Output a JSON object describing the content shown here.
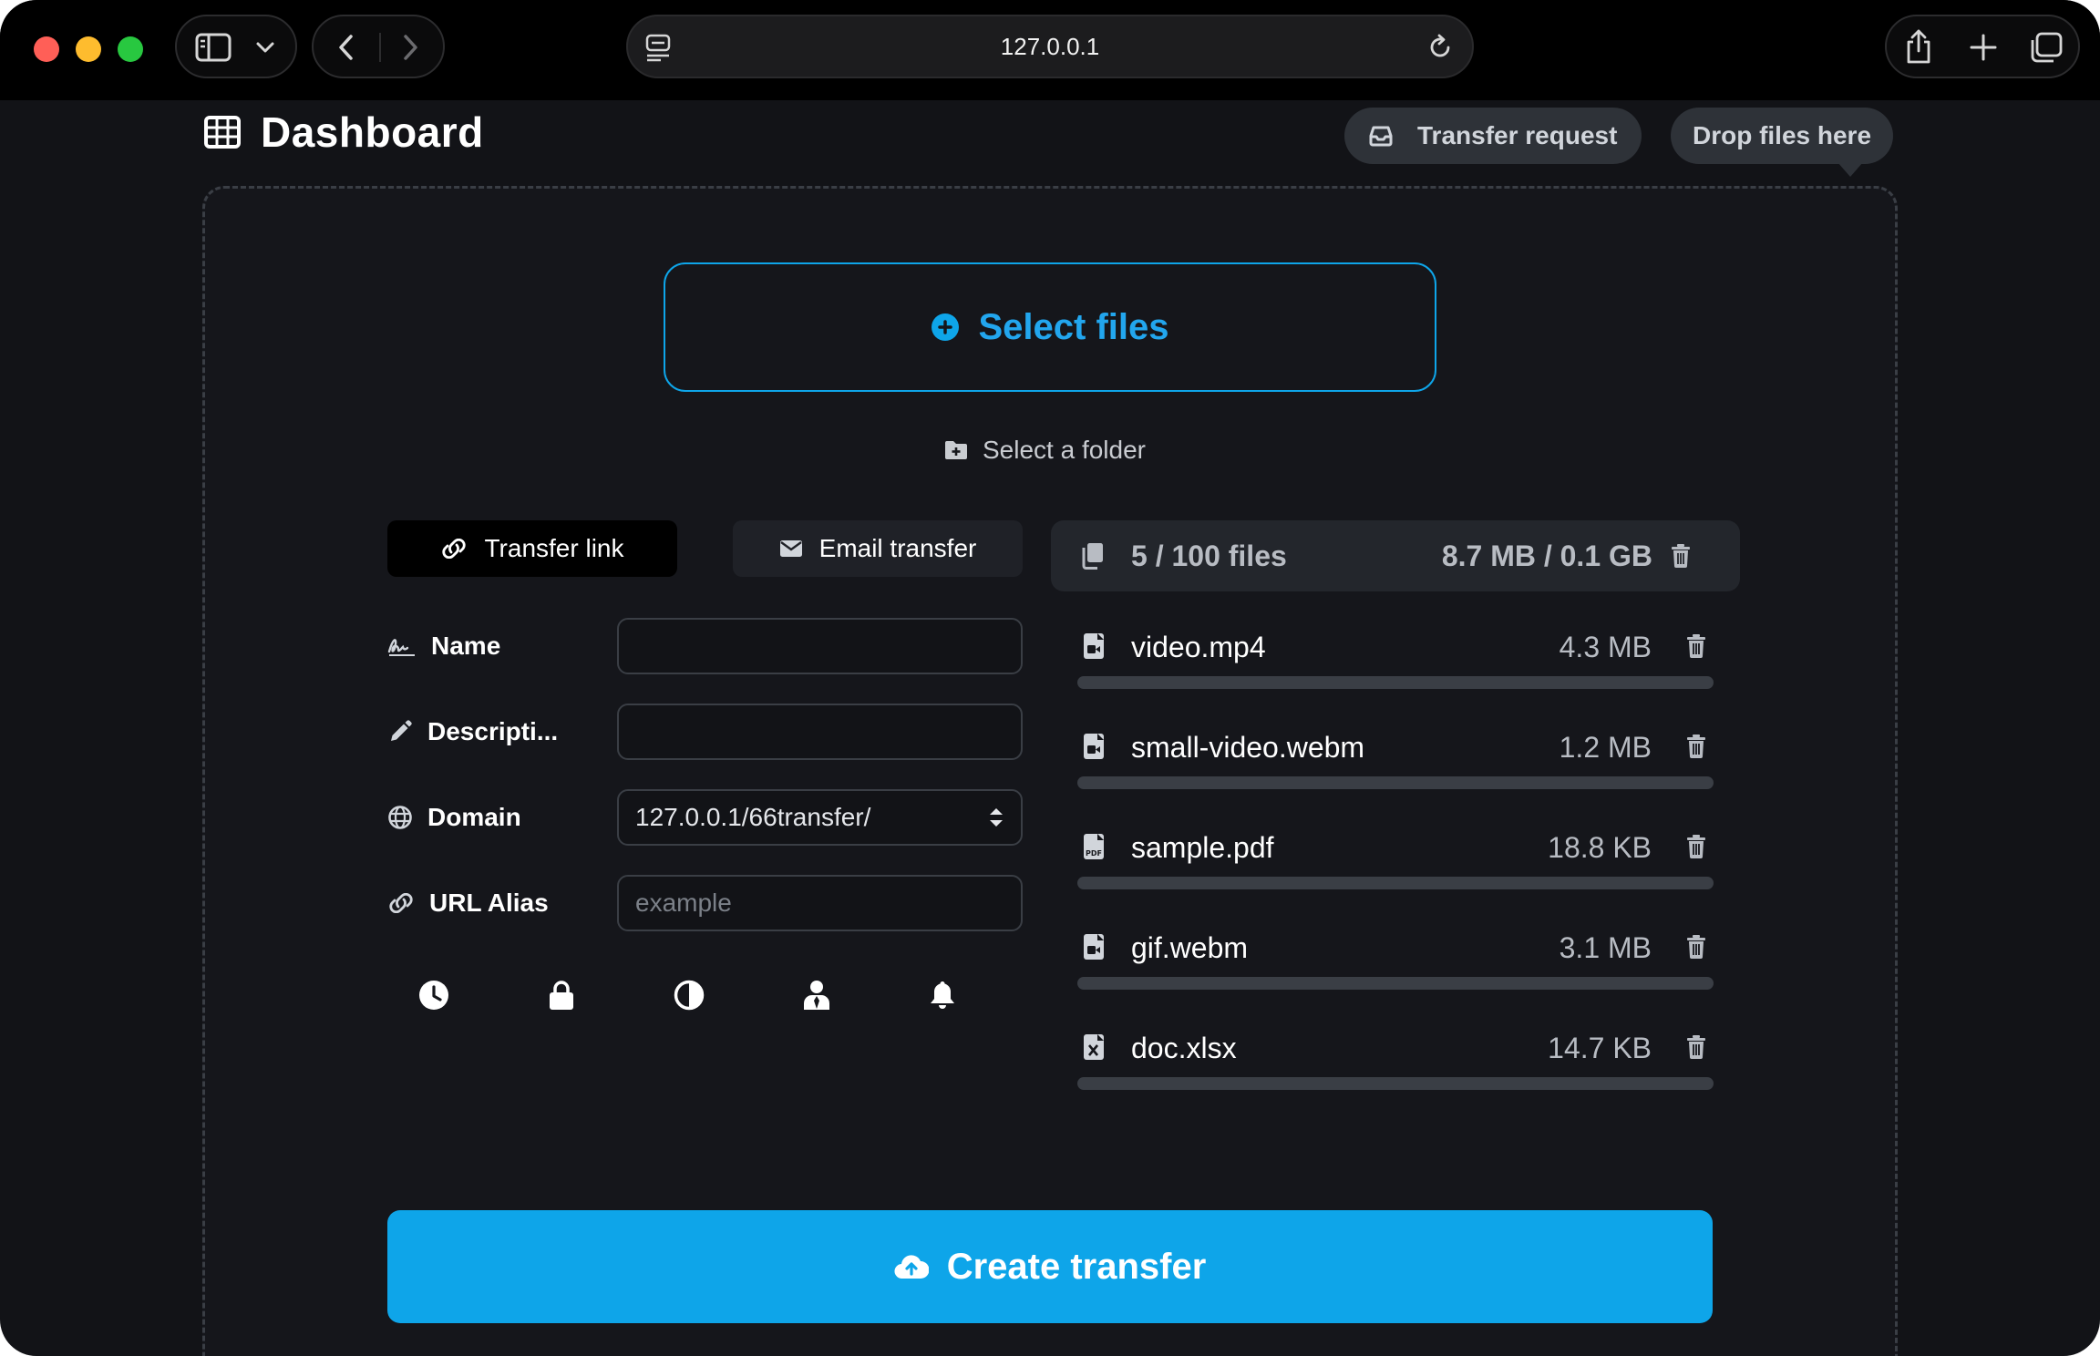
{
  "browser": {
    "url": "127.0.0.1"
  },
  "header": {
    "title": "Dashboard",
    "transfer_request_label": "Transfer request",
    "drop_files_label": "Drop files here"
  },
  "upload": {
    "select_files_label": "Select files",
    "select_folder_label": "Select a folder"
  },
  "tabs": [
    {
      "label": "Transfer link",
      "active": true
    },
    {
      "label": "Email transfer",
      "active": false
    }
  ],
  "form": {
    "name_label": "Name",
    "name_value": "",
    "description_label": "Descripti...",
    "description_value": "",
    "domain_label": "Domain",
    "domain_value": "127.0.0.1/66transfer/",
    "alias_label": "URL Alias",
    "alias_placeholder": "example",
    "option_icons": [
      "clock-icon",
      "lock-icon",
      "contrast-icon",
      "user-tie-icon",
      "bell-icon"
    ]
  },
  "files": {
    "count_label": "5 / 100 files",
    "total_size_label": "8.7 MB / 0.1 GB",
    "items": [
      {
        "name": "video.mp4",
        "size": "4.3 MB",
        "icon": "file-video-icon"
      },
      {
        "name": "small-video.webm",
        "size": "1.2 MB",
        "icon": "file-video-icon"
      },
      {
        "name": "sample.pdf",
        "size": "18.8 KB",
        "icon": "file-pdf-icon"
      },
      {
        "name": "gif.webm",
        "size": "3.1 MB",
        "icon": "file-video-icon"
      },
      {
        "name": "doc.xlsx",
        "size": "14.7 KB",
        "icon": "file-excel-icon"
      }
    ]
  },
  "actions": {
    "create_label": "Create transfer"
  },
  "colors": {
    "accent": "#0ea5e9",
    "background": "#15161b",
    "surface": "#23262c",
    "traffic_red": "#ff5f57",
    "traffic_yellow": "#febc2e",
    "traffic_green": "#28c840"
  }
}
